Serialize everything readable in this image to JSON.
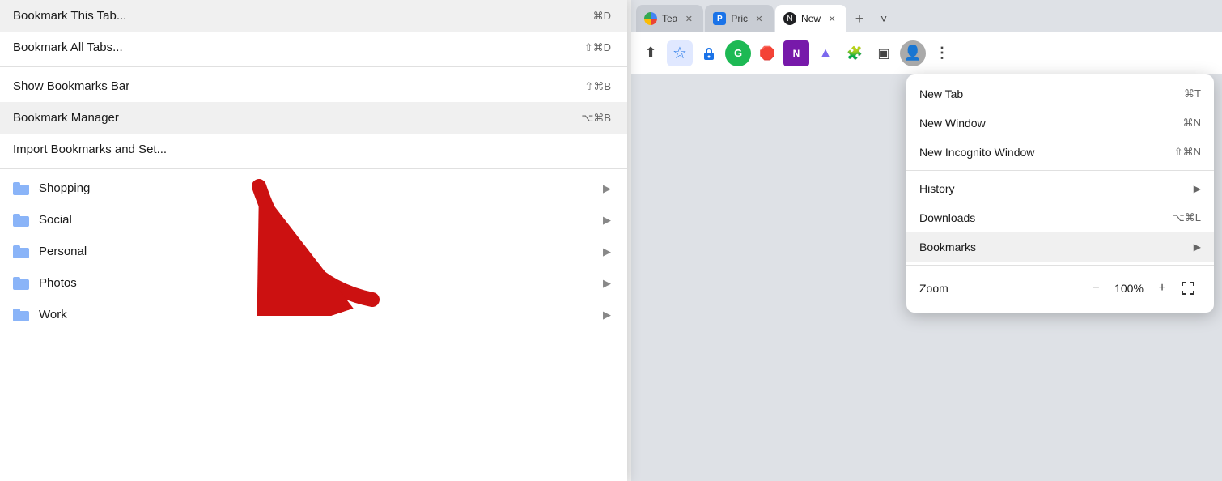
{
  "browser": {
    "tabs": [
      {
        "id": "tab1",
        "title": "Tea",
        "favicon_color": "#4285f4",
        "active": false,
        "favicon_type": "google"
      },
      {
        "id": "tab2",
        "title": "Pric",
        "favicon_color": "#1a73e8",
        "active": false,
        "favicon_type": "blue"
      },
      {
        "id": "tab3",
        "title": "New",
        "favicon_color": "#202124",
        "active": true,
        "favicon_type": "dark"
      }
    ],
    "tab_new_label": "+",
    "tab_overflow_label": "❯"
  },
  "toolbar": {
    "share_icon": "⬆",
    "bookmark_icon": "☆",
    "lock_icon": "🔒",
    "grammarly_icon": "G",
    "adblock_icon": "🛑",
    "onenote_icon": "N",
    "clickup_icon": "▲",
    "extensions_icon": "🧩",
    "sidebar_icon": "▣",
    "profile_icon": "👤",
    "menu_icon": "⋮"
  },
  "bookmark_menu": {
    "items": [
      {
        "id": "bm1",
        "label": "Bookmark This Tab...",
        "shortcut": "⌘D",
        "type": "action",
        "highlighted": false
      },
      {
        "id": "bm2",
        "label": "Bookmark All Tabs...",
        "shortcut": "⇧⌘D",
        "type": "action",
        "highlighted": false
      },
      {
        "id": "sep1",
        "type": "separator"
      },
      {
        "id": "bm3",
        "label": "Show Bookmarks Bar",
        "shortcut": "⇧⌘B",
        "type": "action",
        "highlighted": false
      },
      {
        "id": "bm4",
        "label": "Bookmark Manager",
        "shortcut": "⌥⌘B",
        "type": "action",
        "highlighted": true
      },
      {
        "id": "bm5",
        "label": "Import Bookmarks and Set...",
        "shortcut": "",
        "type": "action",
        "highlighted": false
      },
      {
        "id": "sep2",
        "type": "separator"
      },
      {
        "id": "bm6",
        "label": "Shopping",
        "shortcut": "",
        "type": "folder",
        "highlighted": false
      },
      {
        "id": "bm7",
        "label": "Social",
        "shortcut": "",
        "type": "folder",
        "highlighted": false
      },
      {
        "id": "bm8",
        "label": "Personal",
        "shortcut": "",
        "type": "folder",
        "highlighted": false
      },
      {
        "id": "bm9",
        "label": "Photos",
        "shortcut": "",
        "type": "folder",
        "highlighted": false
      },
      {
        "id": "bm10",
        "label": "Work",
        "shortcut": "",
        "type": "folder",
        "highlighted": false
      }
    ]
  },
  "chrome_menu": {
    "items": [
      {
        "id": "cm1",
        "label": "New Tab",
        "shortcut": "⌘T",
        "type": "action",
        "highlighted": false,
        "arrow": false
      },
      {
        "id": "cm2",
        "label": "New Window",
        "shortcut": "⌘N",
        "type": "action",
        "highlighted": false,
        "arrow": false
      },
      {
        "id": "cm3",
        "label": "New Incognito Window",
        "shortcut": "⇧⌘N",
        "type": "action",
        "highlighted": false,
        "arrow": false
      },
      {
        "id": "sep1",
        "type": "separator"
      },
      {
        "id": "cm4",
        "label": "History",
        "shortcut": "",
        "type": "action",
        "highlighted": false,
        "arrow": true
      },
      {
        "id": "cm5",
        "label": "Downloads",
        "shortcut": "⌥⌘L",
        "type": "action",
        "highlighted": false,
        "arrow": false
      },
      {
        "id": "cm6",
        "label": "Bookmarks",
        "shortcut": "",
        "type": "action",
        "highlighted": true,
        "arrow": true
      },
      {
        "id": "sep2",
        "type": "separator"
      }
    ],
    "zoom": {
      "label": "Zoom",
      "minus": "−",
      "value": "100%",
      "plus": "+",
      "fullscreen": "⛶"
    }
  }
}
